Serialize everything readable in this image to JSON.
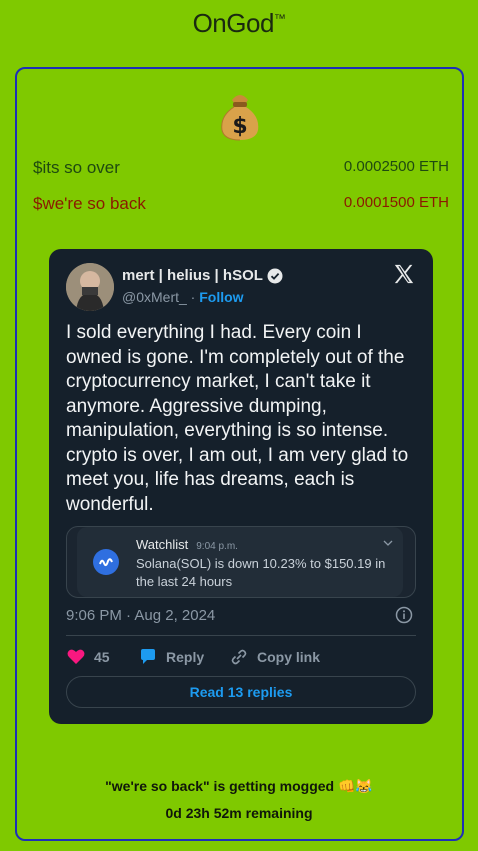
{
  "app": {
    "title": "OnGod",
    "title_mark": "™"
  },
  "rows": [
    {
      "label": "$its so over",
      "value": "0.0002500 ETH",
      "color": "#1f4a10"
    },
    {
      "label": "$we're so back",
      "value": "0.0001500 ETH",
      "color": "#8b1a00"
    }
  ],
  "tweet": {
    "author_name": "mert | helius | hSOL",
    "handle": "@0xMert_",
    "separator": " · ",
    "follow_label": "Follow",
    "text": "I sold everything I had. Every coin I owned is gone. I'm completely out of the cryptocurrency market, I can't take it anymore. Aggressive dumping, manipulation, everything is so intense. crypto is over, I am out, I am very glad to meet you, life has dreams, each is wonderful.",
    "embedded_card": {
      "title": "Watchlist",
      "time": "9:04 p.m.",
      "text": "Solana(SOL) is down 10.23% to $150.19 in the last 24 hours"
    },
    "timestamp": "9:06 PM · Aug 2, 2024",
    "likes": "45",
    "reply_label": "Reply",
    "copy_label": "Copy link",
    "read_replies_label": "Read 13 replies"
  },
  "footer": {
    "status": "\"we're so back\" is getting mogged 👊😹",
    "remaining": "0d 23h 52m remaining"
  },
  "colors": {
    "background": "#7fc900",
    "frame_border": "#1e2fb8",
    "tweet_bg": "#15202b",
    "accent": "#1d9bf0",
    "like": "#f91880"
  }
}
